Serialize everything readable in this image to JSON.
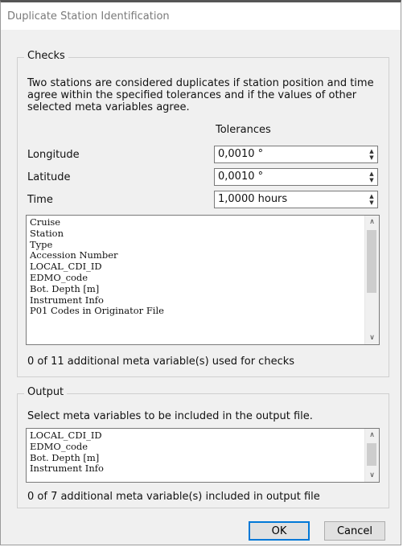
{
  "window": {
    "title": "Duplicate Station Identification"
  },
  "checks": {
    "legend": "Checks",
    "description": "Two stations are considered duplicates if station position and time agree within the specified tolerances and if the values of other selected meta variables agree.",
    "tolerances_header": "Tolerances",
    "longitude": {
      "label": "Longitude",
      "value": "0,0010 °"
    },
    "latitude": {
      "label": "Latitude",
      "value": "0,0010 °"
    },
    "time": {
      "label": "Time",
      "value": "1,0000 hours"
    },
    "meta_list": [
      "Cruise",
      "Station",
      "Type",
      "Accession Number",
      "LOCAL_CDI_ID",
      "EDMO_code",
      "Bot. Depth [m]",
      "Instrument Info",
      "P01 Codes in Originator File"
    ],
    "summary": "0 of 11 additional meta variable(s) used for checks"
  },
  "output": {
    "legend": "Output",
    "instruction": "Select meta variables to be included in the output file.",
    "meta_list": [
      "LOCAL_CDI_ID",
      "EDMO_code",
      "Bot. Depth [m]",
      "Instrument Info"
    ],
    "summary": "0 of 7 additional meta variable(s) included in output file"
  },
  "buttons": {
    "ok": "OK",
    "cancel": "Cancel"
  }
}
